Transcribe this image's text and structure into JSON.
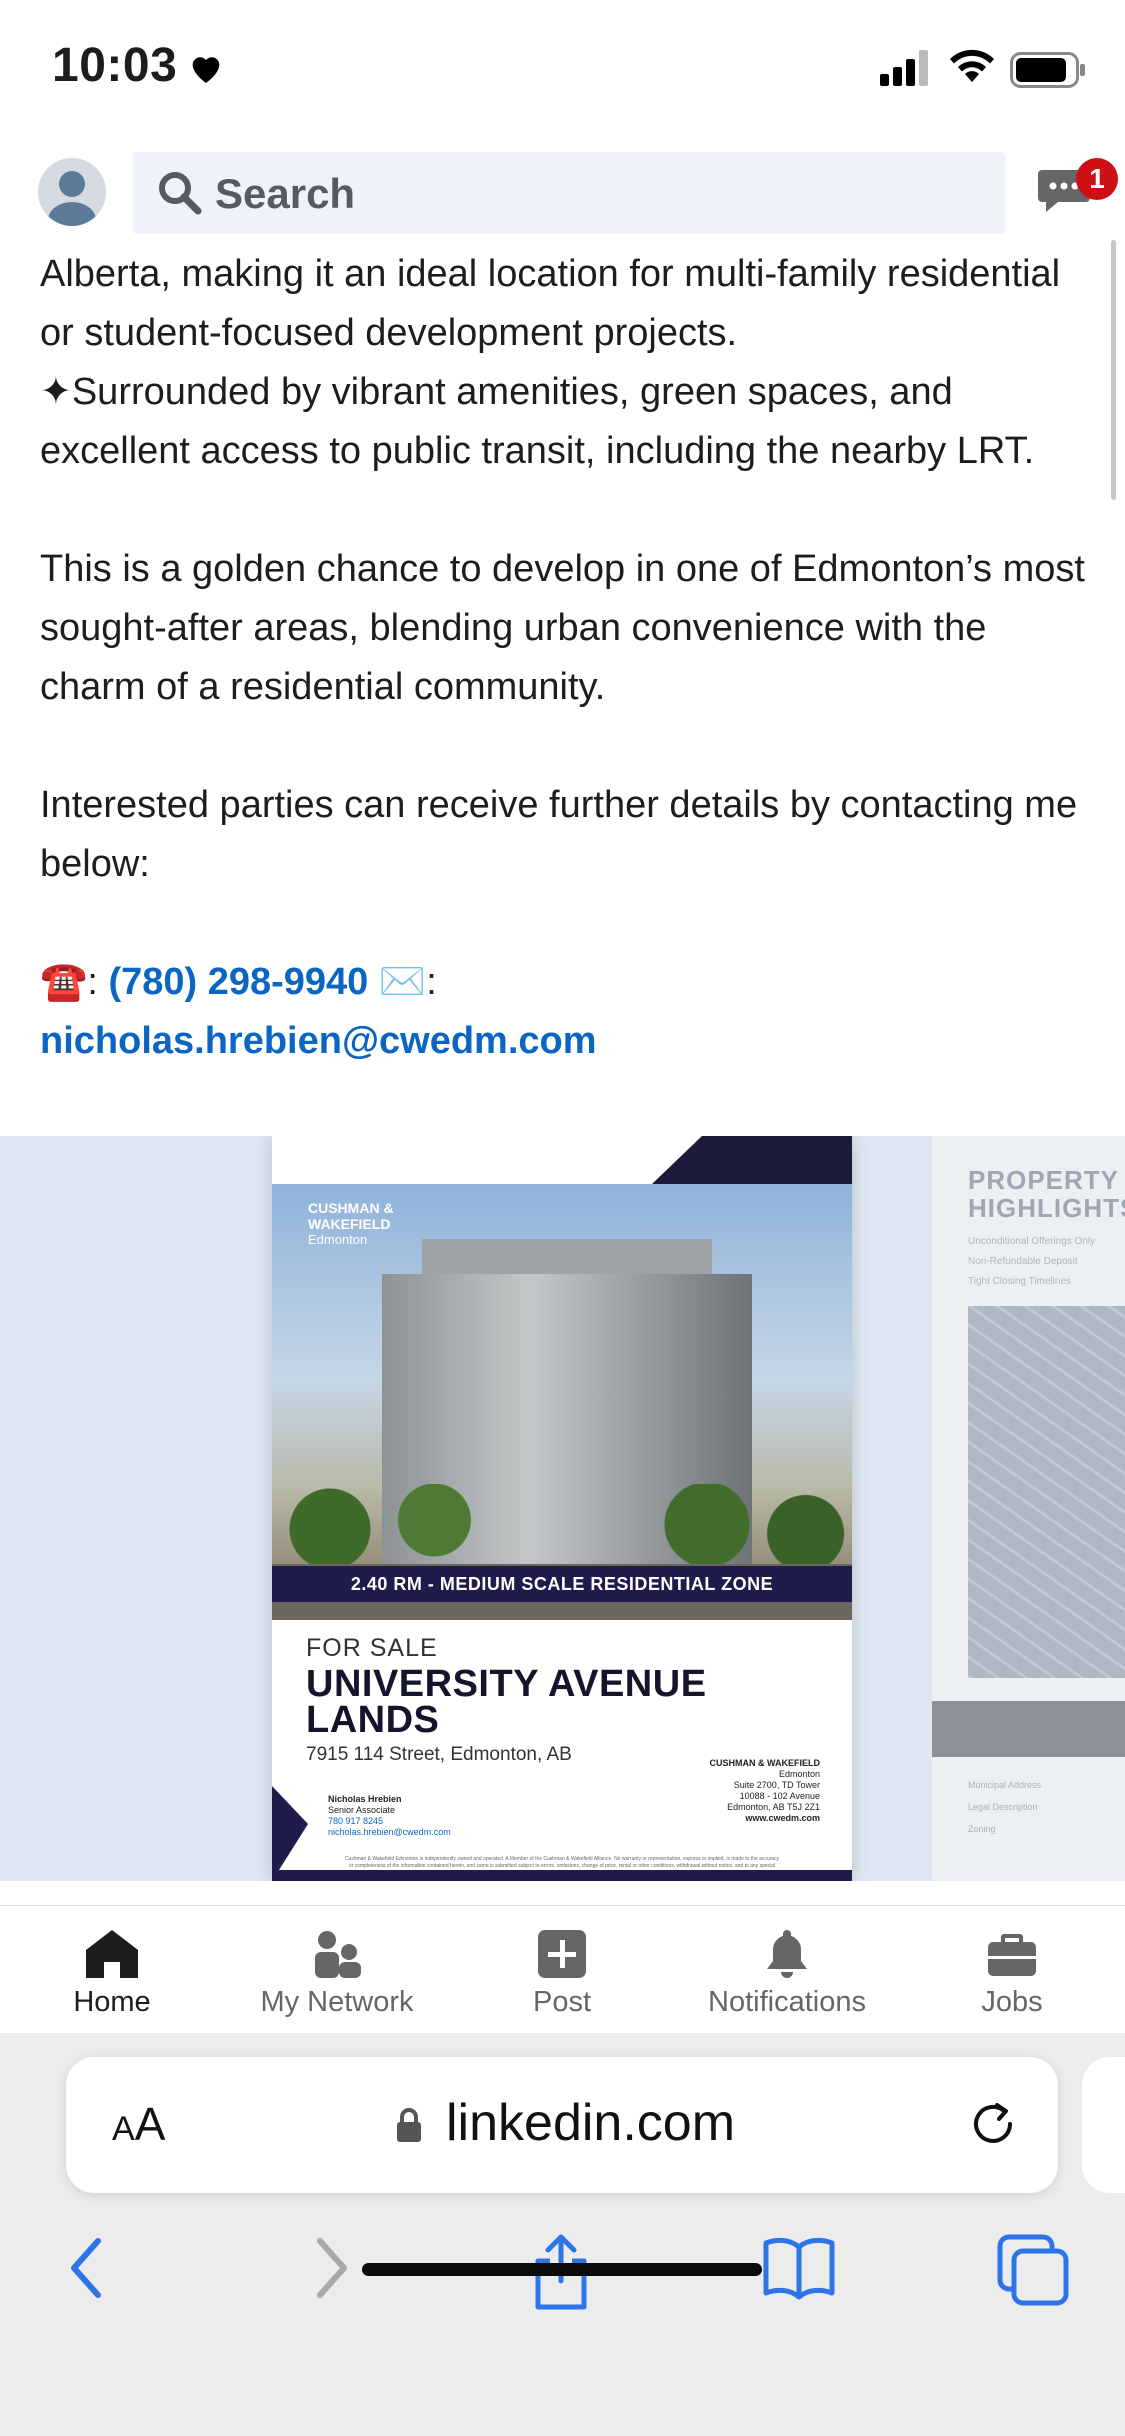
{
  "status_bar": {
    "time": "10:03"
  },
  "header": {
    "search_placeholder": "Search",
    "messages_badge": "1"
  },
  "post": {
    "paragraphs": [
      "Alberta, making it an ideal location for multi-family residential or student-focused development projects.",
      "✦Surrounded by vibrant amenities, green spaces, and excellent access to public transit, including the nearby LRT.",
      "This is a golden chance to develop in one of Edmonton’s most sought-after areas, blending urban convenience with the charm of a residential community.",
      "Interested parties can receive further details by contacting me below:"
    ],
    "phone_emoji": "☎️",
    "phone_sep": ":",
    "phone": "(780) 298-9940",
    "email_emoji": "✉️",
    "email_sep": ":",
    "email": "nicholas.hrebien@cwedm.com"
  },
  "brochure": {
    "brand_line1": "CUSHMAN &",
    "brand_line2": "WAKEFIELD",
    "brand_line3": "Edmonton",
    "zone_band": "2.40 RM - MEDIUM SCALE RESIDENTIAL ZONE",
    "for_sale": "FOR SALE",
    "title": "UNIVERSITY AVENUE LANDS",
    "address": "7915 114 Street, Edmonton, AB",
    "agent_name": "Nicholas Hrebien",
    "agent_title": "Senior Associate",
    "agent_phone": "780 917 8245",
    "agent_email": "nicholas.hrebien@cwedm.com",
    "office_name": "CUSHMAN & WAKEFIELD",
    "office_city": "Edmonton",
    "office_suite": "Suite 2700, TD Tower",
    "office_street": "10088 - 102 Avenue",
    "office_postal": "Edmonton, AB T5J 2Z1",
    "office_web": "www.cwedm.com",
    "disclaimer": "Cushman & Wakefield Edmonton is independently owned and operated. A Member of the Cushman & Wakefield Alliance. No warranty or representation, express or implied, is made to the accuracy or completeness of the information contained herein, and same is submitted subject to errors, omissions, change of price, rental or other conditions, withdrawal without notice, and to any special listing conditions imposed by the property owner(s). As applicable, we make no representation as to the condition of the property (or properties) in question. Mar 25 2024"
  },
  "brochure_page2": {
    "title_line1": "PROPERTY",
    "title_line2": "HIGHLIGHTS",
    "bullets": [
      "Unconditional Offerings Only",
      "Non-Refundable Deposit",
      "Tight Closing Timelines"
    ],
    "rows": [
      "Municipal Address",
      "Legal Description",
      "Zoning"
    ]
  },
  "bottom_nav": {
    "items": [
      {
        "label": "Home",
        "icon": "home-icon"
      },
      {
        "label": "My Network",
        "icon": "network-icon"
      },
      {
        "label": "Post",
        "icon": "plus-square-icon"
      },
      {
        "label": "Notifications",
        "icon": "bell-icon"
      },
      {
        "label": "Jobs",
        "icon": "briefcase-icon"
      }
    ]
  },
  "safari": {
    "aa_label_small": "A",
    "aa_label": "A",
    "url": "linkedin.com"
  },
  "colors": {
    "linkedin_blue": "#0a66c2",
    "badge_red": "#cc1016",
    "safari_blue": "#2d74e8",
    "search_bg": "#edf3f8",
    "navy": "#1f1b4a"
  }
}
